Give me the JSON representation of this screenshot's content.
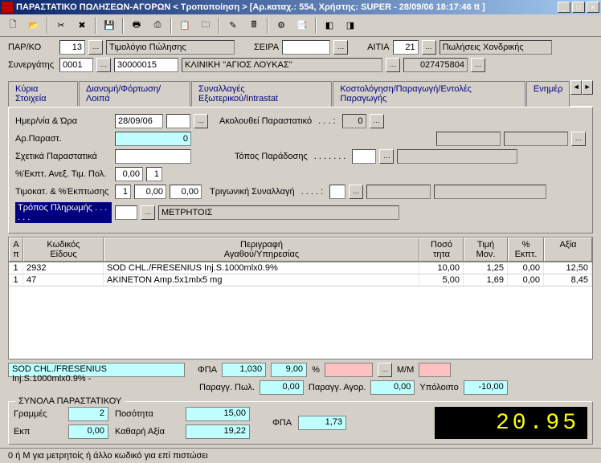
{
  "title": "ΠΑΡΑΣΤΑΤΙΚΟ ΠΩΛΗΣΕΩΝ-ΑΓΟΡΩΝ < Τροποποίηση > [Αρ.καταχ.: 554, Χρήστης: SUPER - 28/09/06 18:17:46 tt ]",
  "header": {
    "par_ko_label": "ΠΑΡ/ΚΟ",
    "par_ko": "13",
    "par_ko_desc": "Τιμολόγιο Πώλησης",
    "seira_label": "ΣΕΙΡΑ",
    "seira": "",
    "aitia_label": "ΑΙΤΙΑ",
    "aitia": "21",
    "aitia_desc": "Πωλήσεις Χονδρικής",
    "synergatis_label": "Συνεργάτης",
    "syn_code": "0001",
    "syn_afm": "30000015",
    "syn_name": "ΚΛΙΝΙΚΗ ''ΑΓΙΟΣ ΛΟΥΚΑΣ''",
    "syn_phone": "027475804"
  },
  "tabs": {
    "main": "Κύρια Στοιχεία",
    "dist": "Διανομή/Φόρτωση/Λοιπά",
    "intra": "Συναλλαγές Εξωτερικού/Intrastat",
    "cost": "Κοστολόγηση/Παραγωγή/Εντολές Παραγωγής",
    "upd": "Ενημέρ"
  },
  "form": {
    "date_label": "Ημερ/νία & Ώρα",
    "date": "28/09/06",
    "follow_label": "Ακολουθεί Παραστατικό",
    "follow": "0",
    "arparast_label": "Αρ.Παραστ.",
    "arparast": "0",
    "sxetika_label": "Σχετικά Παραστατικά",
    "topos_label": "Τόπος Παράδοσης",
    "ekpt_anex_label": "%Έκπτ. Ανεξ. Τιμ. Πολ.",
    "ekpt_anex": "0,00",
    "ekpt_anex2": "1",
    "timokat_label": "Τιμοκατ. & %Έκπτωσης",
    "timokat1": "1",
    "timokat2": "0,00",
    "timokat3": "0,00",
    "trig_label": "Τριγωνική Συναλλαγή",
    "tropos_label": "Τρόπος Πληρωμής . . . . . .",
    "tropos_val": "ΜΕΤΡΗΤΟΙΣ"
  },
  "grid": {
    "h_ap": "Α\nπ",
    "h_code": "Κωδικός\nΕίδους",
    "h_desc": "Περιγραφή\nΑγαθού/Υπηρεσίας",
    "h_qty": "Ποσό\nτητα",
    "h_price": "Τιμή\nΜον.",
    "h_disc": "%\nΕκπτ.",
    "h_val": "Αξία",
    "rows": [
      {
        "ap": "1",
        "code": "2932",
        "desc": "SOD CHL./FRESENIUS Inj.S.1000mlx0.9%",
        "qty": "10,00",
        "price": "1,25",
        "disc": "0,00",
        "val": "12,50"
      },
      {
        "ap": "1",
        "code": "47",
        "desc": "AKINETON Amp.5x1mlx5 mg",
        "qty": "5,00",
        "price": "1,69",
        "disc": "0,00",
        "val": "8,45"
      }
    ]
  },
  "status": {
    "item_desc": "SOD  CHL./FRESENIUS Inj.S.1000mlx0.9%  -",
    "fpa_label": "ΦΠΑ",
    "fpa_val": "1,030",
    "fpa_pct": "9,00",
    "pct": "%",
    "mm_label": "Μ/Μ",
    "parpwl_label": "Παραγγ. Πωλ.",
    "parpwl": "0,00",
    "parag_label": "Παραγγ. Αγορ.",
    "parag": "0,00",
    "ypol_label": "Υπόλοιπο",
    "ypol": "-10,00"
  },
  "totals": {
    "legend": "ΣΥΝΟΛΑ ΠΑΡΑΣΤΑΤΙΚΟΥ",
    "lines_label": "Γραμμές",
    "lines": "2",
    "qty_label": "Ποσότητα",
    "qty": "15,00",
    "ekp_label": "Εκπ",
    "ekp": "0,00",
    "net_label": "Καθαρή Αξία",
    "net": "19,22",
    "fpa_label": "ΦΠΑ",
    "fpa": "1,73",
    "grand": "20.95"
  },
  "footer": "0 ή Μ για μετρητοίς ή άλλο κωδικό για επί πιστώσει"
}
